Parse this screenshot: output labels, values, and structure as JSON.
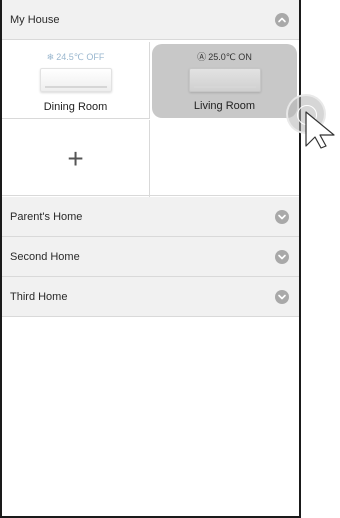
{
  "groups": [
    {
      "title": "My House",
      "expanded": true
    },
    {
      "title": "Parent's Home",
      "expanded": false
    },
    {
      "title": "Second Home",
      "expanded": false
    },
    {
      "title": "Third Home",
      "expanded": false
    }
  ],
  "rooms": [
    {
      "name": "Dining Room",
      "status": "24.5℃ OFF",
      "mode_icon": "snowflake-icon",
      "power": "off"
    },
    {
      "name": "Living Room",
      "status": "25.0℃ ON",
      "mode_icon": "auto-mode-icon",
      "power": "on"
    }
  ],
  "add_room": {
    "glyph": "+"
  },
  "colors": {
    "header_bg": "#f1f1f1",
    "chevron": "#a9a9a9",
    "selected_room_bg": "#c8c8c8",
    "off_status": "#9ab7cf"
  }
}
